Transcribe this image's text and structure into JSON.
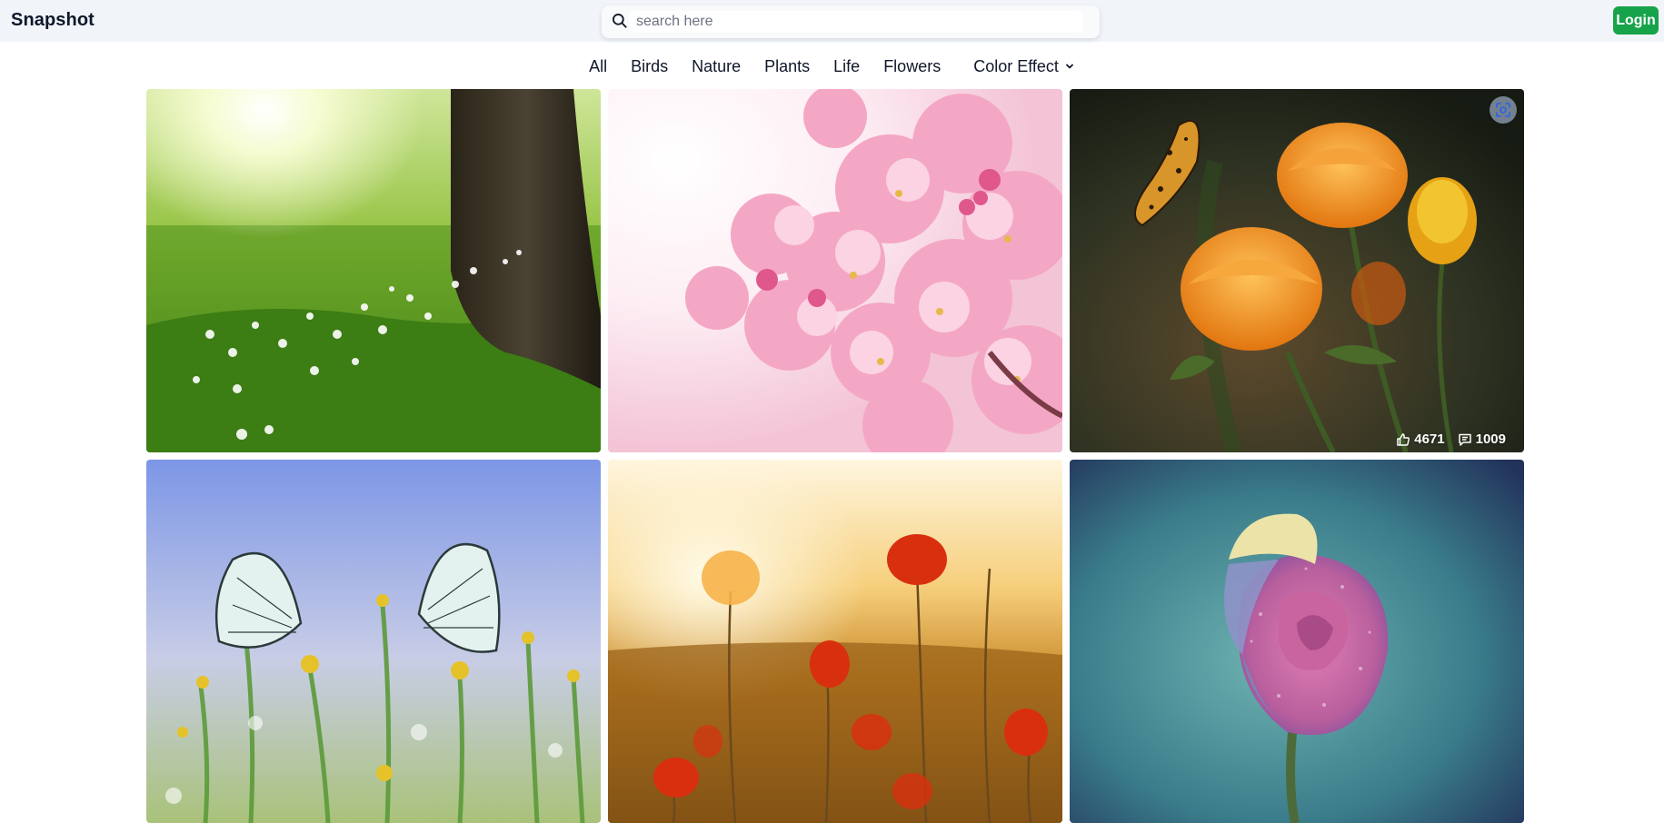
{
  "header": {
    "brand": "Snapshot",
    "search_placeholder": "search here",
    "login_label": "Login"
  },
  "nav": {
    "items": [
      "All",
      "Birds",
      "Nature",
      "Plants",
      "Life",
      "Flowers"
    ],
    "dropdown_label": "Color Effect"
  },
  "photos": [
    {
      "subject": "meadow with tree and white flowers"
    },
    {
      "subject": "pink cherry blossoms"
    },
    {
      "subject": "orange flowers with butterfly",
      "likes": "4671",
      "comments": "1009"
    },
    {
      "subject": "white butterflies on wildflowers"
    },
    {
      "subject": "poppies at sunset"
    },
    {
      "subject": "multicolor rose"
    }
  ],
  "icons": {
    "search": "search-icon",
    "chevron": "chevron-down-icon",
    "lens": "lens-scan-icon",
    "like": "thumbs-up-icon",
    "comment": "comment-icon"
  },
  "colors": {
    "header_bg": "#f1f5f9",
    "login_bg": "#16a34a"
  }
}
